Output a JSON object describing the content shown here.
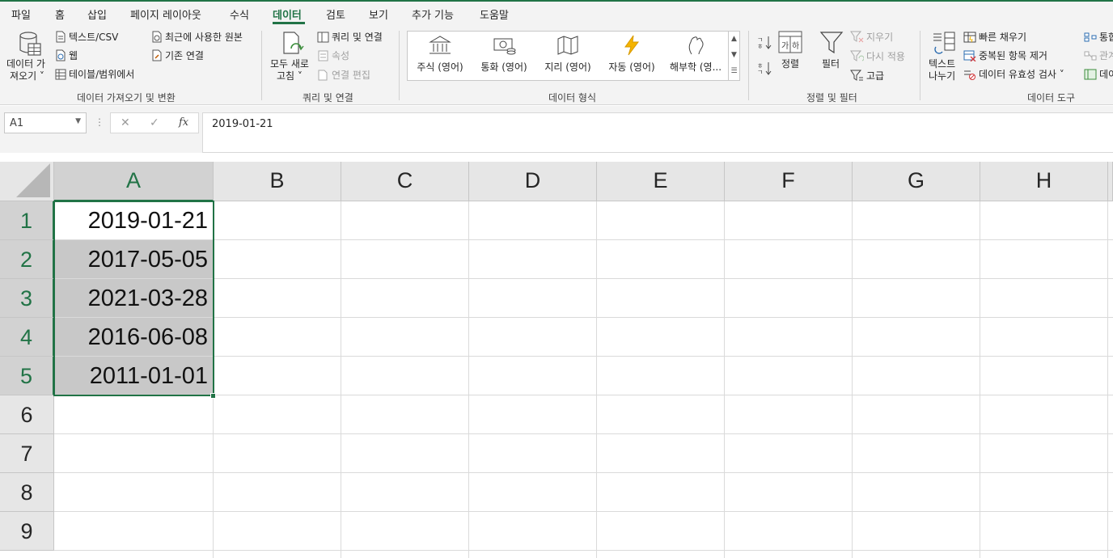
{
  "menu": {
    "tabs": [
      "파일",
      "홈",
      "삽입",
      "페이지 레이아웃",
      "수식",
      "데이터",
      "검토",
      "보기",
      "추가 기능",
      "도움말"
    ],
    "active": "데이터"
  },
  "ribbon": {
    "get_data": {
      "big_label_1": "데이터 가",
      "big_label_2": "져오기 ˅",
      "text_csv": "텍스트/CSV",
      "web": "웹",
      "table_range": "테이블/범위에서",
      "recent_sources": "최근에 사용한 원본",
      "existing_connections": "기존 연결",
      "group_label": "데이터 가져오기 및 변환"
    },
    "queries": {
      "refresh_1": "모두 새로",
      "refresh_2": "고침 ˅",
      "queries_connections": "쿼리 및 연결",
      "properties": "속성",
      "edit_links": "연결 편집",
      "group_label": "쿼리 및 연결"
    },
    "data_types": {
      "items": [
        "주식 (영어)",
        "통화 (영어)",
        "지리 (영어)",
        "자동 (영어)",
        "해부학 (영..."
      ],
      "group_label": "데이터 형식"
    },
    "sort_filter": {
      "sort": "정렬",
      "filter": "필터",
      "clear": "지우기",
      "reapply": "다시 적용",
      "advanced": "고급",
      "sort_icon_text": "가나\n하가",
      "group_label": "정렬 및 필터"
    },
    "data_tools": {
      "text_to_columns_1": "텍스트",
      "text_to_columns_2": "나누기",
      "flash_fill": "빠른 채우기",
      "remove_duplicates": "중복된 항목 제거",
      "data_validation": "데이터 유효성 검사 ˅",
      "consolidate": "통합",
      "relationships": "관계",
      "data_model": "데이",
      "group_label": "데이터 도구"
    }
  },
  "formula_bar": {
    "name_box": "A1",
    "cancel": "✕",
    "enter": "✓",
    "fx": "fx",
    "value": "2019-01-21"
  },
  "sheet": {
    "columns": [
      "A",
      "B",
      "C",
      "D",
      "E",
      "F",
      "G",
      "H"
    ],
    "rows": [
      "1",
      "2",
      "3",
      "4",
      "5",
      "6",
      "7",
      "8",
      "9"
    ],
    "cells_a": [
      "2019-01-21",
      "2017-05-05",
      "2021-03-28",
      "2016-06-08",
      "2011-01-01"
    ]
  }
}
